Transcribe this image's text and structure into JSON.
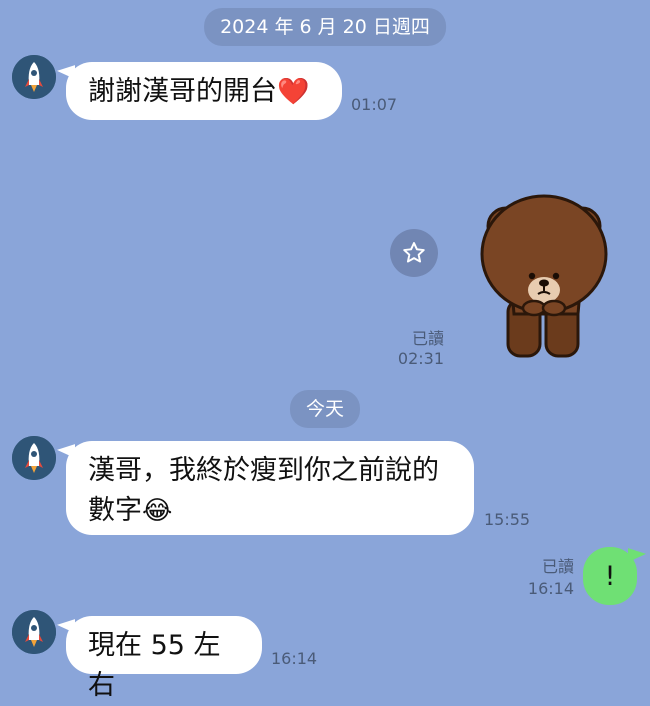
{
  "date_divider_1": "2024 年 6 月 20 日週四",
  "date_divider_2": "今天",
  "messages": [
    {
      "text": "謝謝漢哥的開台",
      "emoji": "❤️",
      "time": "01:07"
    },
    {
      "sticker": "brown-bear-sticker",
      "read_label": "已讀",
      "time": "02:31"
    },
    {
      "text_line1": "漢哥，我終於瘦到你之前說的",
      "text_line2": "數字",
      "emoji": "😂",
      "time": "15:55"
    },
    {
      "text": "!",
      "read_label": "已讀",
      "time": "16:14"
    },
    {
      "text": "現在 55 左右",
      "time": "16:14"
    }
  ],
  "icons": {
    "avatar": "rocket-avatar-icon",
    "sticker_action": "star-icon"
  },
  "colors": {
    "background": "#8aa5d9",
    "outgoing_bubble": "#6fe074",
    "incoming_bubble": "#ffffff"
  }
}
